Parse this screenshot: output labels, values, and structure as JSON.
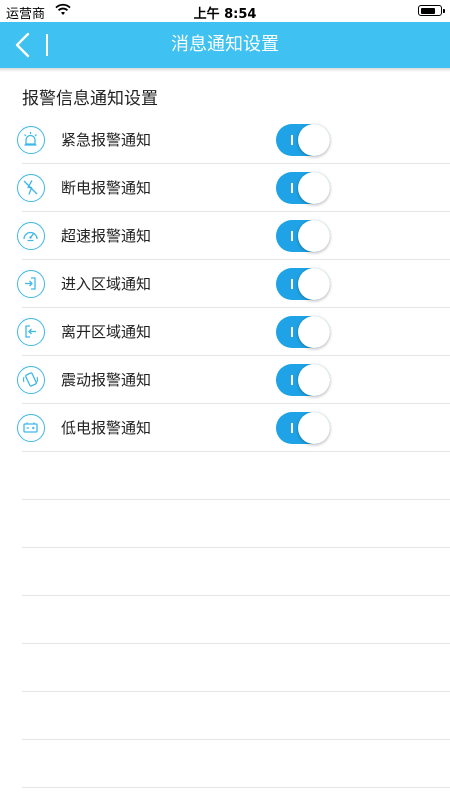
{
  "status_bar": {
    "carrier": "运营商",
    "time": "上午 8:54"
  },
  "nav": {
    "title": "消息通知设置"
  },
  "section_title": "报警信息通知设置",
  "items": [
    {
      "icon": "alarm-light-icon",
      "label": "紧急报警通知",
      "enabled": true
    },
    {
      "icon": "power-off-icon",
      "label": "断电报警通知",
      "enabled": true
    },
    {
      "icon": "speedometer-icon",
      "label": "超速报警通知",
      "enabled": true
    },
    {
      "icon": "enter-area-icon",
      "label": "进入区域通知",
      "enabled": true
    },
    {
      "icon": "exit-area-icon",
      "label": "离开区域通知",
      "enabled": true
    },
    {
      "icon": "vibration-icon",
      "label": "震动报警通知",
      "enabled": true
    },
    {
      "icon": "low-battery-icon",
      "label": "低电报警通知",
      "enabled": true
    }
  ],
  "colors": {
    "nav_bar": "#3fc1f2",
    "toggle_on": "#1fa3e6",
    "icon_stroke": "#3fb7ea"
  }
}
